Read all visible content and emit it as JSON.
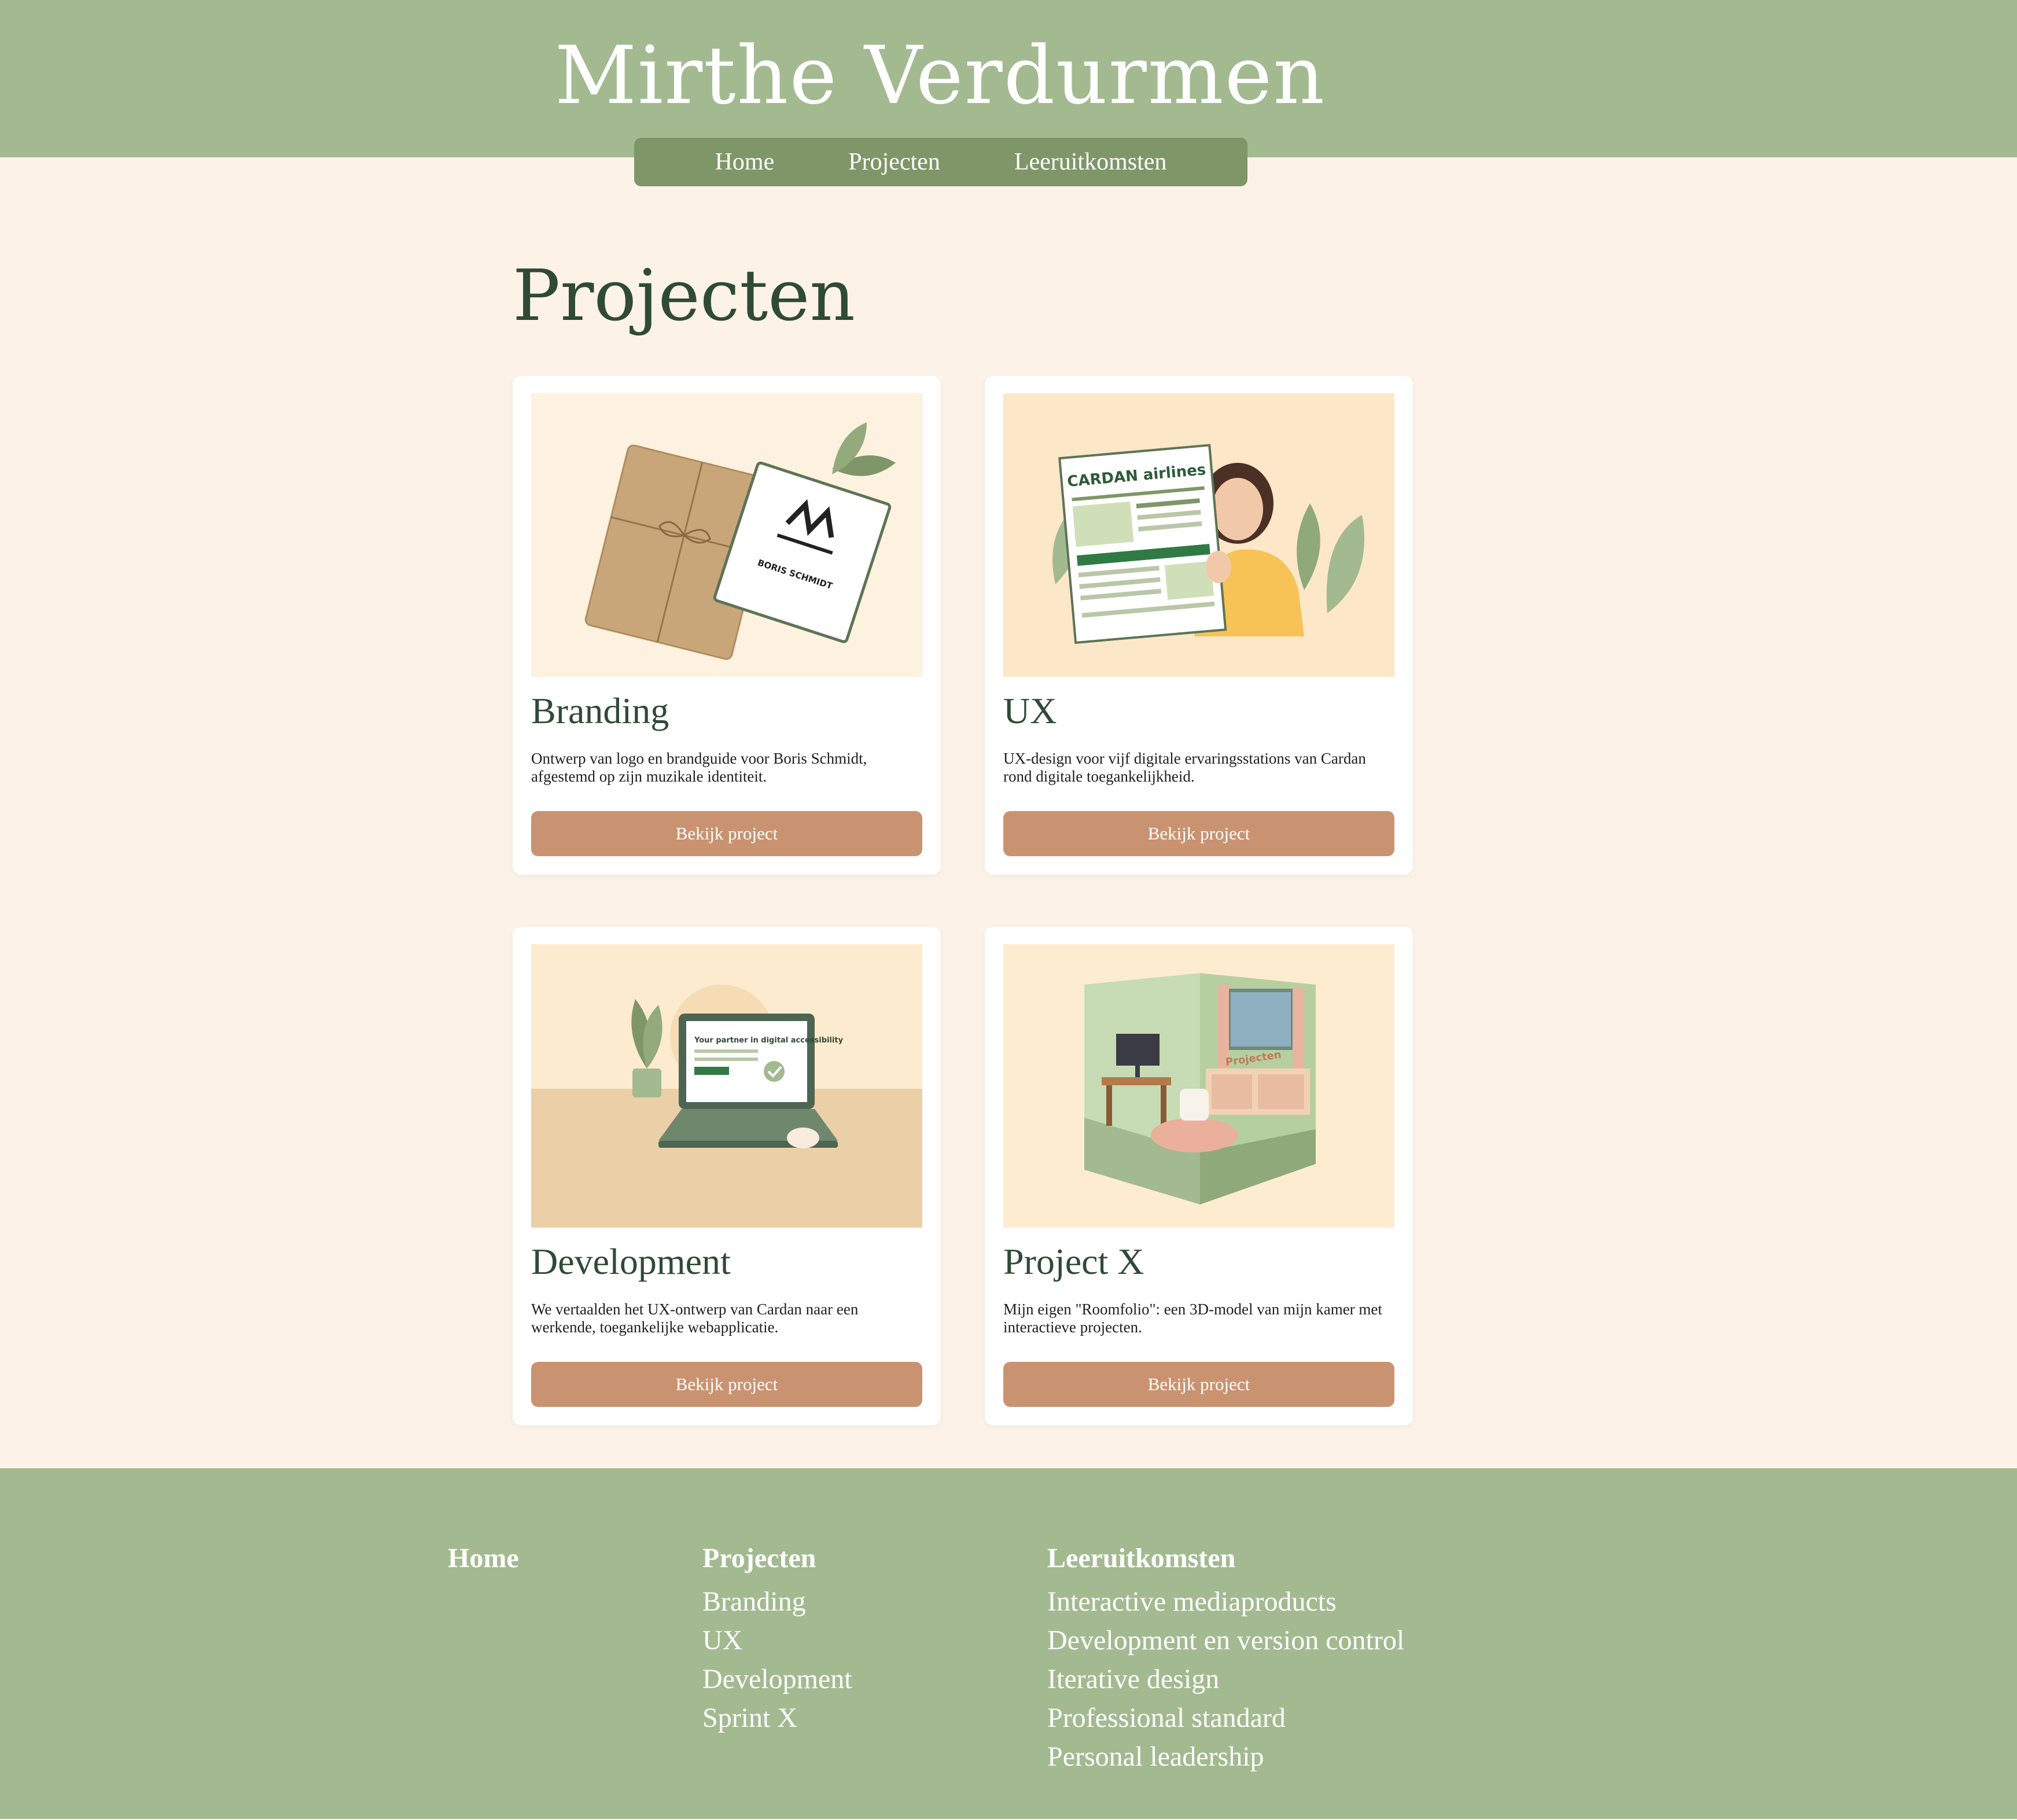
{
  "site": {
    "title": "Mirthe Verdurmen"
  },
  "nav": {
    "items": [
      "Home",
      "Projecten",
      "Leeruitkomsten"
    ]
  },
  "page": {
    "title": "Projecten"
  },
  "cards": [
    {
      "title": "Branding",
      "description": "Ontwerp van logo en brandguide voor Boris Schmidt, afgestemd op zijn muzikale identiteit.",
      "button": "Bekijk project",
      "image_text": "BORIS SCHMIDT"
    },
    {
      "title": "UX",
      "description": "UX-design voor vijf digitale ervaringsstations van Cardan rond digitale toegankelijkheid.",
      "button": "Bekijk project",
      "image_text": "CARDAN airlines"
    },
    {
      "title": "Development",
      "description": "We vertaalden het UX-ontwerp van Cardan naar een werkende, toegankelijke webapplicatie.",
      "button": "Bekijk project",
      "image_text": "Your partner in digital accessibility"
    },
    {
      "title": "Project X",
      "description": "Mijn eigen \"Roomfolio\": een 3D-model van mijn kamer met interactieve projecten.",
      "button": "Bekijk project",
      "image_text": "Projecten"
    }
  ],
  "footer": {
    "home": {
      "heading": "Home"
    },
    "projecten": {
      "heading": "Projecten",
      "links": [
        "Branding",
        "UX",
        "Development",
        "Sprint X"
      ]
    },
    "leeruitkomsten": {
      "heading": "Leeruitkomsten",
      "links": [
        "Interactive mediaproducts",
        "Development en version control",
        "Iterative design",
        "Professional standard",
        "Personal leadership"
      ]
    }
  },
  "colors": {
    "header_green": "#a3ba91",
    "nav_green": "#7f9668",
    "background_cream": "#fdf2e8",
    "title_dark_green": "#2f4a35",
    "button_terracotta": "#c99371"
  }
}
